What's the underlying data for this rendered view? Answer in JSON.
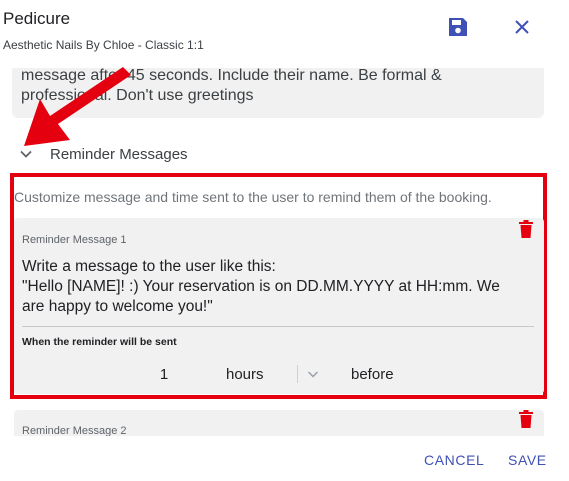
{
  "dialog": {
    "title": "Pedicure",
    "subtitle": "Aesthetic Nails By Chloe - Classic 1:1"
  },
  "prompt_card": {
    "text_line1": "message after 45 seconds. Include their name. Be formal &",
    "text_line2": "professional. Don't use  greetings"
  },
  "reminders": {
    "section_label": "Reminder Messages",
    "intro": "Customize message and time sent to the user to remind them of the booking.",
    "items": [
      {
        "label": "Reminder Message 1",
        "message_line1": "Write a message to the user like this:",
        "message_line2": "\"Hello [NAME]! :) Your reservation is on DD.MM.YYYY at HH:mm. We",
        "message_line3": "are happy to welcome you!\"",
        "when_label": "When the reminder will be sent",
        "amount": "1",
        "unit": "hours",
        "relation": "before"
      },
      {
        "label": "Reminder Message 2"
      }
    ]
  },
  "footer": {
    "cancel_label": "CANCEL",
    "save_label": "SAVE"
  },
  "colors": {
    "accent": "#3f51b5",
    "delete_icon": "#e4000f",
    "annotation_red": "#e4000f",
    "card_bg": "#f1f1f1"
  }
}
